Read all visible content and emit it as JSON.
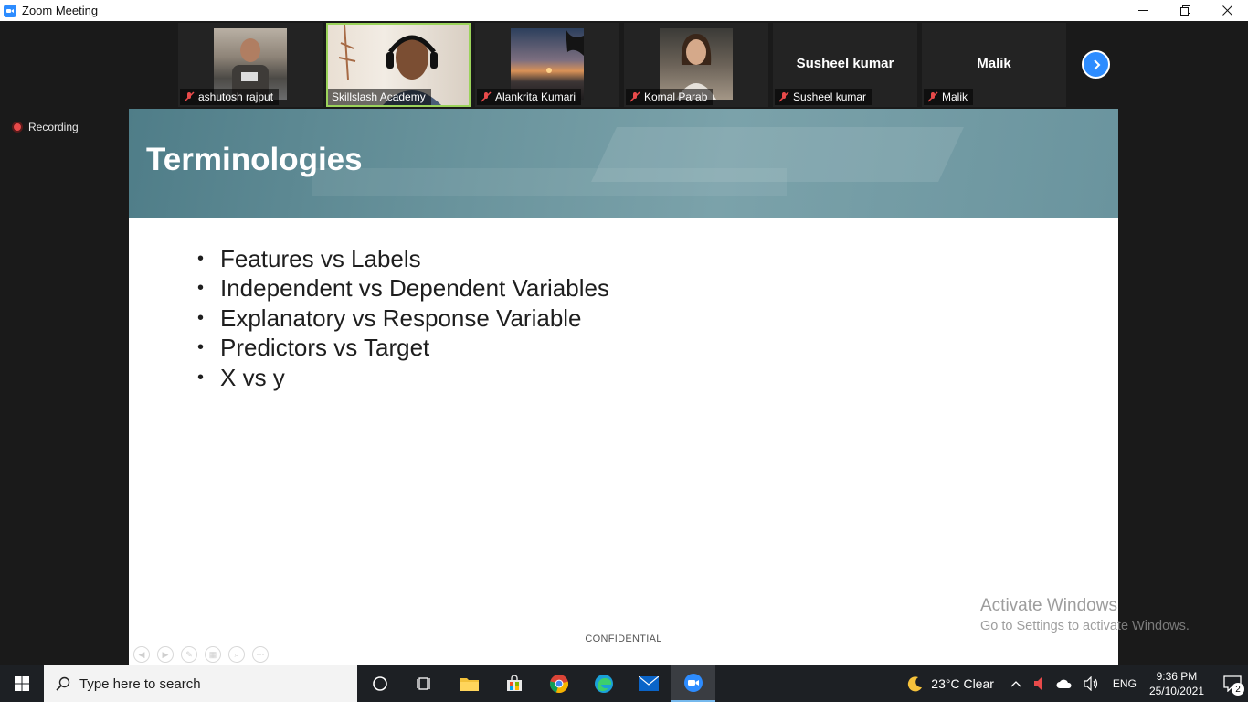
{
  "window": {
    "title": "Zoom Meeting"
  },
  "participants": [
    {
      "name": "ashutosh rajput",
      "muted": true,
      "video": true
    },
    {
      "name": "Skillslash Academy",
      "muted": false,
      "video": true,
      "active_speaker": true
    },
    {
      "name": "Alankrita Kumari",
      "muted": true,
      "video": true
    },
    {
      "name": "Komal Parab",
      "muted": true,
      "video": true
    },
    {
      "name": "Susheel kumar",
      "muted": true,
      "video": false,
      "display_name": "Susheel kumar"
    },
    {
      "name": "Malik",
      "muted": true,
      "video": false,
      "display_name": "Malik"
    }
  ],
  "recording": {
    "label": "Recording"
  },
  "slide": {
    "title": "Terminologies",
    "bullets": [
      "Features vs Labels",
      "Independent vs Dependent Variables",
      "Explanatory vs Response Variable",
      "Predictors vs Target",
      "X vs y"
    ],
    "footer": "CONFIDENTIAL"
  },
  "watermark": {
    "line1": "Activate Windows",
    "line2": "Go to Settings to activate Windows."
  },
  "taskbar": {
    "search_placeholder": "Type here to search",
    "weather": "23°C  Clear",
    "language": "ENG",
    "time": "9:36 PM",
    "date": "25/10/2021",
    "notification_count": "2"
  },
  "colors": {
    "zoom_blue": "#2d8cff",
    "active_speaker": "#9bd35a",
    "recording_red": "#e84a4a",
    "header_teal": "#6a949d"
  }
}
